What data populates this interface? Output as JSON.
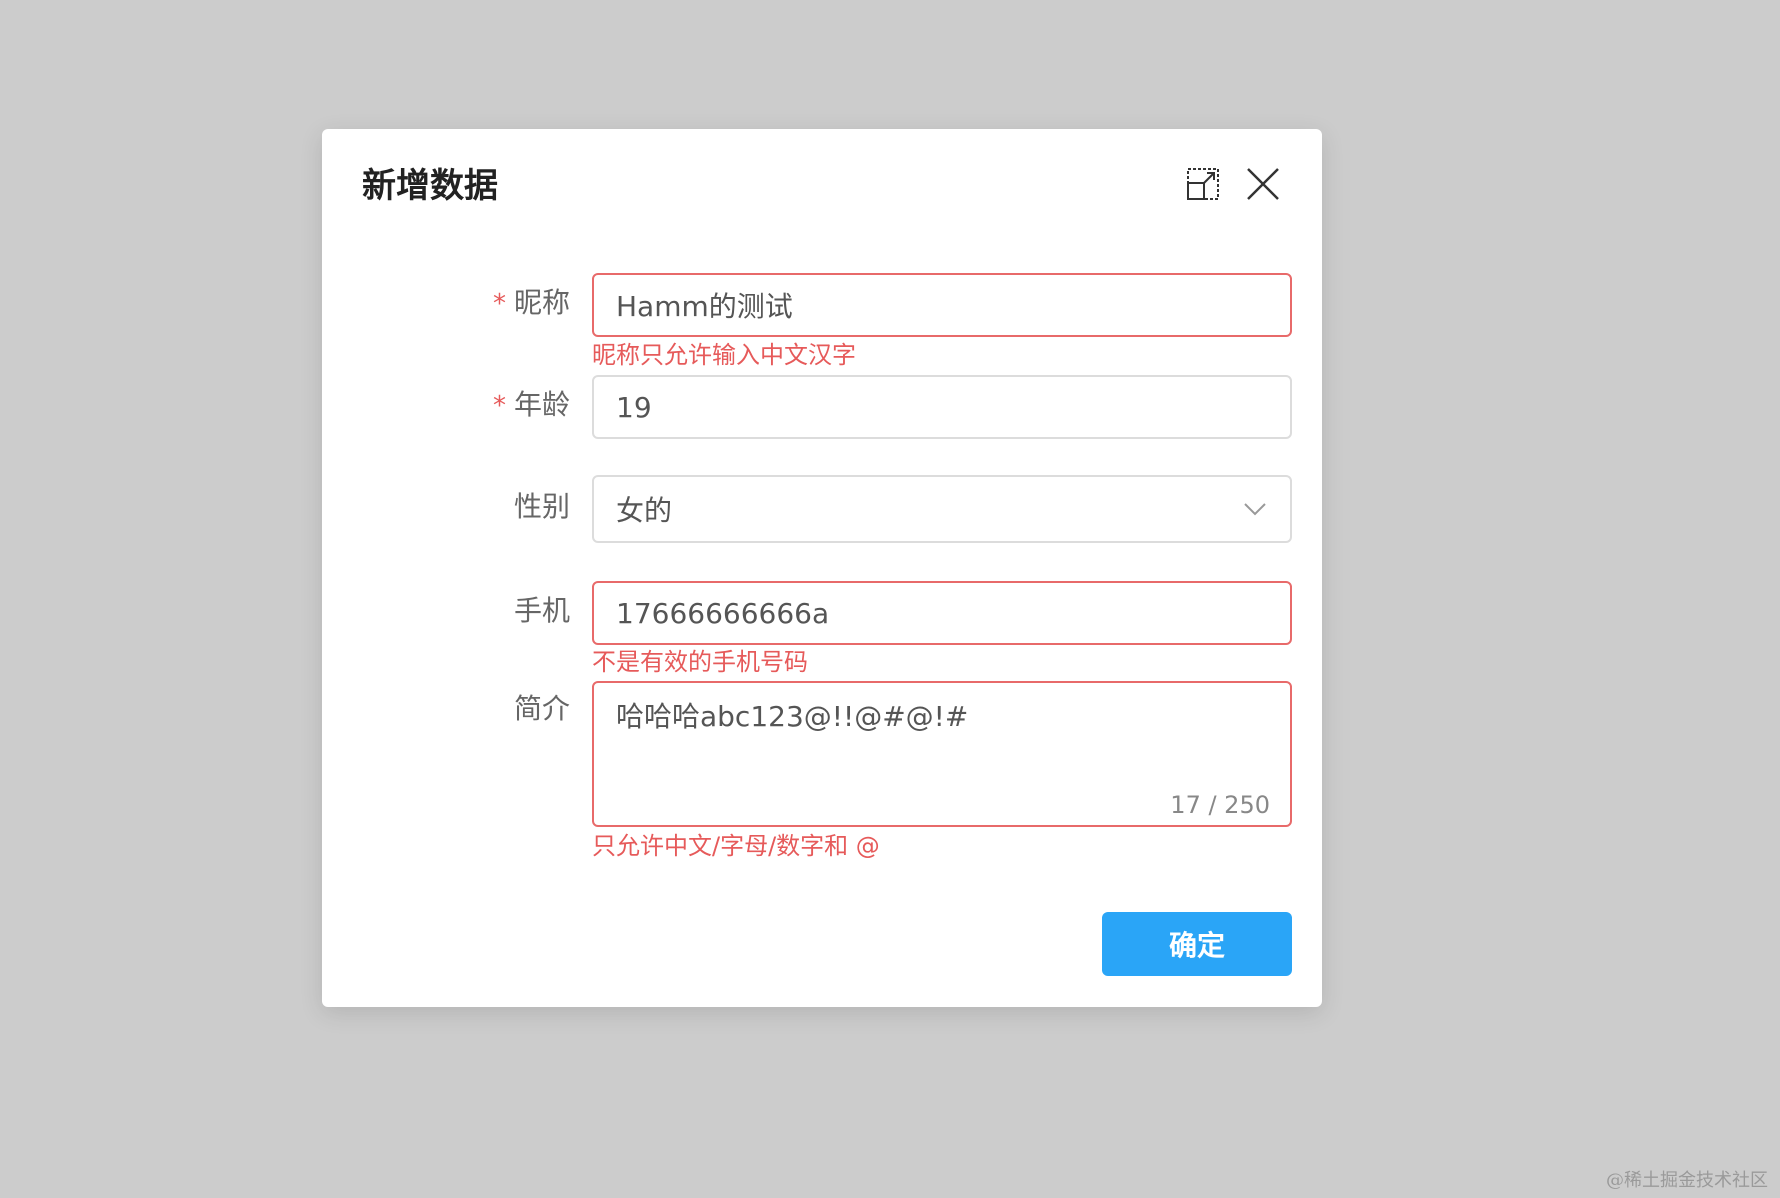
{
  "dialog": {
    "title": "新增数据",
    "fullscreen_icon": "fullscreen-icon",
    "close_icon": "close-icon"
  },
  "form": {
    "nickname": {
      "label": "昵称",
      "required_mark": "*",
      "value": "Hamm的测试",
      "error": "昵称只允许输入中文汉字"
    },
    "age": {
      "label": "年龄",
      "required_mark": "*",
      "value": "19"
    },
    "gender": {
      "label": "性别",
      "value": "女的",
      "arrow_icon": "chevron-down-icon"
    },
    "phone": {
      "label": "手机",
      "value": "17666666666a",
      "error": "不是有效的手机号码"
    },
    "intro": {
      "label": "简介",
      "value": "哈哈哈abc123@!!@#@!#",
      "counter": "17 / 250",
      "error": "只允许中文/字母/数字和 @"
    }
  },
  "actions": {
    "confirm_label": "确定"
  },
  "watermark": "@稀土掘金技术社区",
  "colors": {
    "backdrop": "#cccccc",
    "error": "#e65a5a",
    "primary": "#2aa5f7"
  }
}
